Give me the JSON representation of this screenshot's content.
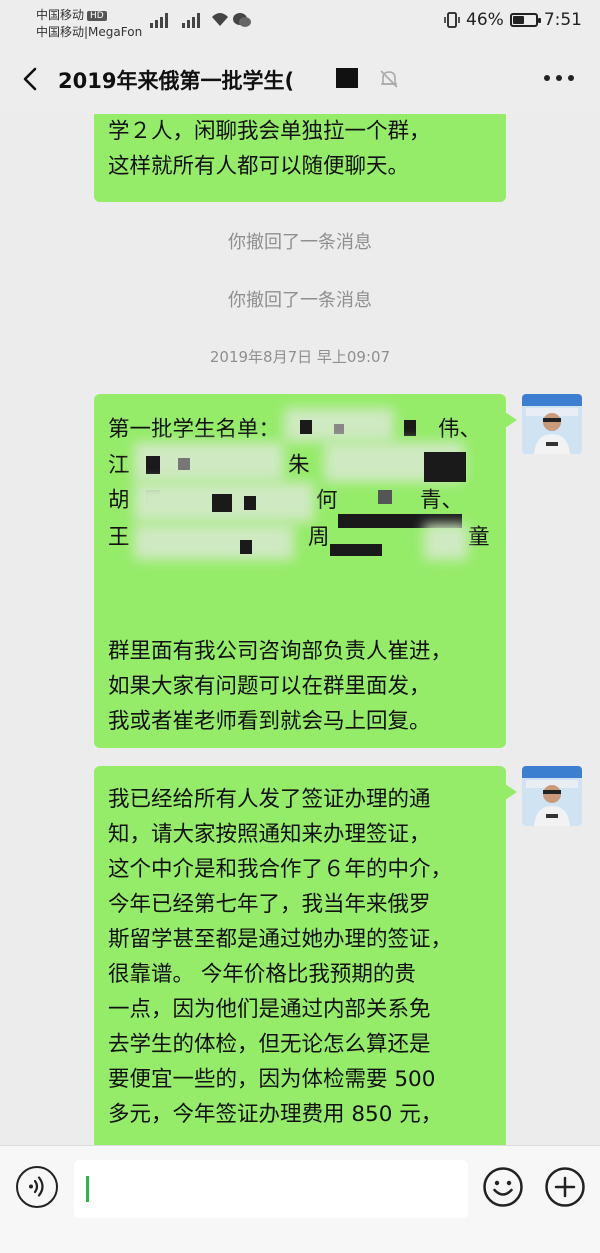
{
  "status_bar": {
    "carrier_primary": "中国移动",
    "hd_badge": "HD",
    "carrier_secondary": "中国移动|MegaFon",
    "battery_text": "46%",
    "battery_level": 0.46,
    "time": "7:51"
  },
  "header": {
    "title": "2019年来俄第一批学生(",
    "icons": [
      "back-icon",
      "mute-bell-icon",
      "more-icon"
    ]
  },
  "messages": {
    "m1": {
      "lines": [
        "学２人，闲聊我会单独拉一个群，",
        "这样就所有人都可以随便聊天。"
      ]
    },
    "recall_1": "你撤回了一条消息",
    "recall_2": "你撤回了一条消息",
    "timestamp": "2019年8月7日 早上09:07",
    "m2": {
      "lines": [
        "第一批学生名单：",
        "伟、",
        "江",
        "朱",
        "胡",
        "何",
        "青、",
        "王",
        "周",
        "童"
      ],
      "body": [
        "群里面有我公司咨询部负责人崔进，",
        "如果大家有问题可以在群里面发，",
        "我或者崔老师看到就会马上回复。"
      ]
    },
    "m3": {
      "lines": [
        "我已经给所有人发了签证办理的通",
        "知，请大家按照通知来办理签证，",
        "这个中介是和我合作了６年的中介，",
        "今年已经第七年了，我当年来俄罗",
        "斯留学甚至都是通过她办理的签证，",
        "很靠谱。  今年价格比我预期的贵",
        "一点，因为他们是通过内部关系免",
        "去学生的体检，但无论怎么算还是",
        "要便宜一些的，因为体检需要 500",
        "多元，今年签证办理费用 850 元，"
      ]
    }
  },
  "input_bar": {
    "icons": [
      "voice-icon",
      "emoji-icon",
      "plus-icon"
    ],
    "value": ""
  },
  "colors": {
    "bubble": "#95ec69",
    "background": "#ececec",
    "caret": "#2fb44a"
  }
}
